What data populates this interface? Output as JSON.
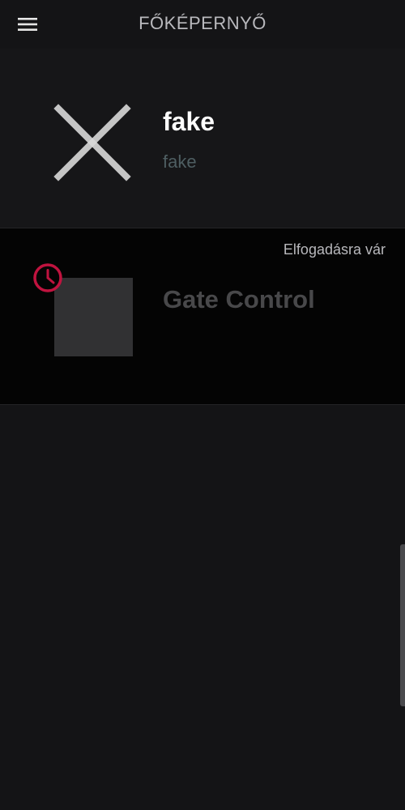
{
  "header": {
    "title": "FŐKÉPERNYŐ",
    "menu_icon": "hamburger-menu-icon"
  },
  "profile": {
    "name": "fake",
    "subtitle": "fake",
    "avatar_icon": "close-x-icon"
  },
  "devices": [
    {
      "name": "Gate Control",
      "status": "Elfogadásra vár",
      "status_icon": "clock-icon",
      "status_color": "#c0133f"
    }
  ],
  "colors": {
    "background": "#141416",
    "device_card": "#040404",
    "accent": "#c0133f"
  }
}
